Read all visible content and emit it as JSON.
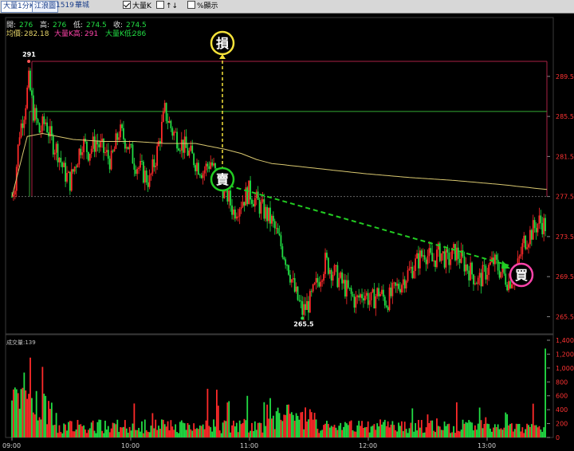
{
  "toolbar": {
    "tab_chart": "大量1分K",
    "tab_detail": "江浪圖",
    "stock_code": "1519",
    "stock_name": "華城",
    "opt_bigk_label": "大量K",
    "opt_bigk_checked": true,
    "opt_arrow_label": "↑↓",
    "opt_arrow_checked": false,
    "opt_pct_label": "%顯示",
    "opt_pct_checked": false
  },
  "info": {
    "open_label": "開:",
    "open": "276",
    "high_label": "高:",
    "high": "276",
    "low_label": "低:",
    "low": "274.5",
    "close_label": "收:",
    "close": "274.5",
    "avg_label": "均價:",
    "avg": "282.18",
    "bigk_high_label": "大量K高:",
    "bigk_high": "291",
    "bigk_low_label": "大量K低:",
    "bigk_low": "286"
  },
  "annotations": {
    "stop": "損",
    "sell": "賣",
    "buy": "買",
    "peak_label": "291",
    "trough_label": "265.5"
  },
  "volume_title": "成交量:139",
  "colors": {
    "up": "#ff2a2a",
    "down": "#22dd44",
    "avg_line": "#d9c870",
    "bigk_line": "#33aa33",
    "high_line": "#aa2244",
    "stop_circle": "#f5e23a",
    "sell_circle": "#22cc22",
    "buy_circle": "#ff44aa",
    "axis_price": "#ff3333"
  },
  "chart_data": [
    {
      "type": "candlestick",
      "title": "",
      "x_ticks": [
        "09:00",
        "10:00",
        "11:00",
        "12:00",
        "13:00"
      ],
      "y_ticks": [
        265.5,
        269.5,
        273.5,
        277.5,
        281.5,
        285.5,
        289.5
      ],
      "ylim": [
        264.5,
        291
      ],
      "grid": false,
      "reference_lines": {
        "bigk_high": 291,
        "bigk_low": 286,
        "prev_close": 277.5
      },
      "price_keypoints": [
        [
          0,
          277.5
        ],
        [
          2,
          279
        ],
        [
          5,
          284
        ],
        [
          8,
          286
        ],
        [
          11,
          289
        ],
        [
          14,
          286
        ],
        [
          18,
          284
        ],
        [
          22,
          285
        ],
        [
          26,
          283
        ],
        [
          30,
          282
        ],
        [
          34,
          280
        ],
        [
          38,
          279
        ],
        [
          42,
          281
        ],
        [
          46,
          283
        ],
        [
          50,
          282
        ],
        [
          55,
          283
        ],
        [
          60,
          282
        ],
        [
          65,
          281
        ],
        [
          70,
          284
        ],
        [
          75,
          283
        ],
        [
          80,
          281
        ],
        [
          85,
          280
        ],
        [
          90,
          279
        ],
        [
          95,
          282
        ],
        [
          100,
          286
        ],
        [
          105,
          284
        ],
        [
          110,
          283
        ],
        [
          115,
          282
        ],
        [
          120,
          281
        ],
        [
          125,
          280
        ],
        [
          130,
          281
        ],
        [
          135,
          279
        ],
        [
          140,
          278
        ],
        [
          145,
          276
        ],
        [
          150,
          277
        ],
        [
          155,
          278
        ],
        [
          160,
          277
        ],
        [
          165,
          276
        ],
        [
          170,
          275
        ],
        [
          175,
          273
        ],
        [
          180,
          271
        ],
        [
          185,
          268
        ],
        [
          190,
          266
        ],
        [
          195,
          267
        ],
        [
          200,
          269
        ],
        [
          205,
          271
        ],
        [
          210,
          270
        ],
        [
          215,
          269
        ],
        [
          220,
          268
        ],
        [
          225,
          267
        ],
        [
          230,
          268
        ],
        [
          235,
          267
        ],
        [
          240,
          268
        ],
        [
          245,
          267
        ],
        [
          250,
          268
        ],
        [
          255,
          269
        ],
        [
          260,
          270
        ],
        [
          265,
          271
        ],
        [
          270,
          272
        ],
        [
          275,
          271
        ],
        [
          280,
          272
        ],
        [
          285,
          271
        ],
        [
          290,
          272
        ],
        [
          295,
          271
        ],
        [
          300,
          270
        ],
        [
          305,
          269
        ],
        [
          310,
          270
        ],
        [
          315,
          271
        ],
        [
          320,
          270
        ],
        [
          325,
          269
        ],
        [
          330,
          270
        ],
        [
          335,
          273
        ],
        [
          340,
          274
        ],
        [
          345,
          275
        ],
        [
          350,
          274.5
        ]
      ],
      "avg_keypoints": [
        [
          0,
          277.5
        ],
        [
          10,
          283.5
        ],
        [
          20,
          283.8
        ],
        [
          40,
          283.2
        ],
        [
          60,
          283
        ],
        [
          80,
          283
        ],
        [
          100,
          282.8
        ],
        [
          120,
          282.8
        ],
        [
          130,
          282.5
        ],
        [
          140,
          282.2
        ],
        [
          150,
          281.8
        ],
        [
          160,
          281.2
        ],
        [
          170,
          280.8
        ],
        [
          200,
          280.3
        ],
        [
          230,
          279.8
        ],
        [
          260,
          279.4
        ],
        [
          290,
          279.1
        ],
        [
          320,
          278.7
        ],
        [
          350,
          278.2
        ]
      ],
      "volume": {
        "ylim": [
          0,
          1400
        ],
        "y_ticks": [
          0,
          200,
          400,
          600,
          800,
          1000,
          1200,
          1400
        ],
        "last": 139
      }
    }
  ]
}
